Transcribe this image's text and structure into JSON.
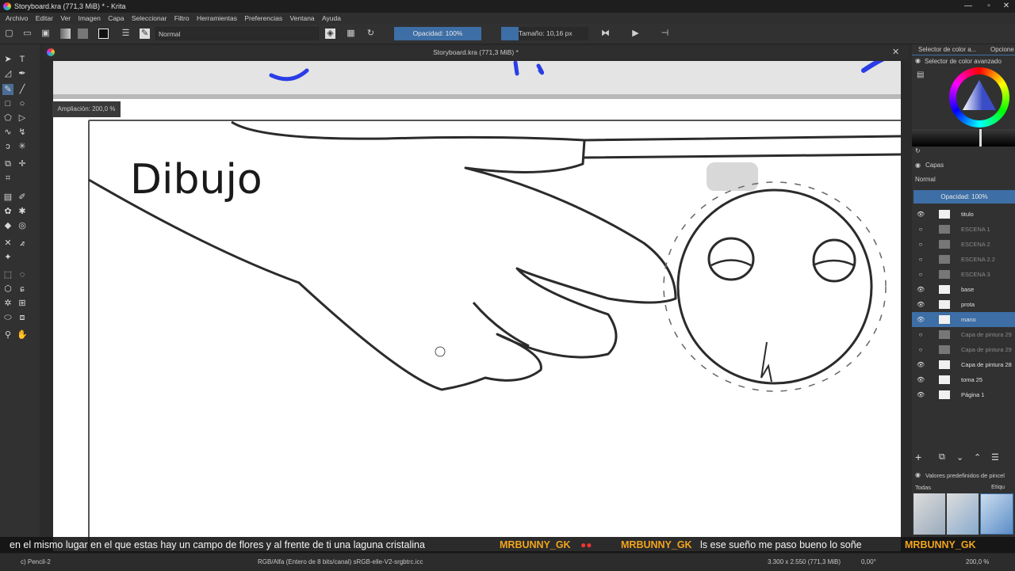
{
  "window": {
    "title": "Storyboard.kra (771,3 MiB) * - Krita"
  },
  "menu": [
    "Archivo",
    "Editar",
    "Ver",
    "Imagen",
    "Capa",
    "Seleccionar",
    "Filtro",
    "Herramientas",
    "Preferencias",
    "Ventana",
    "Ayuda"
  ],
  "toolbar": {
    "blend_mode": "Normal",
    "opacity": "Opacidad: 100%",
    "size": "Tamaño: 10,16 px"
  },
  "document": {
    "tab_title": "Storyboard.kra (771,3 MiB) *",
    "zoom_label": "Ampliación: 200,0 %",
    "canvas_text": "Dibujo"
  },
  "color_selector": {
    "tab1": "Selector de color a...",
    "tab2": "Opcione",
    "title": "Selector de color avanzado"
  },
  "layers": {
    "title": "Capas",
    "blend": "Normal",
    "opacity": "Opacidad:  100%",
    "items": [
      {
        "name": "titulo",
        "visible": true
      },
      {
        "name": "ESCENA 1",
        "visible": false
      },
      {
        "name": "ESCENA 2",
        "visible": false
      },
      {
        "name": "ESCENA 2.2",
        "visible": false
      },
      {
        "name": "ESCENA 3",
        "visible": false
      },
      {
        "name": "base",
        "visible": true
      },
      {
        "name": "prota",
        "visible": true
      },
      {
        "name": "mano",
        "visible": true,
        "selected": true
      },
      {
        "name": "Capa de pintura 29",
        "visible": false
      },
      {
        "name": "Capa de pintura 29",
        "visible": false
      },
      {
        "name": "Capa de pintura 28",
        "visible": true
      },
      {
        "name": "toma 25",
        "visible": true
      },
      {
        "name": "Página 1",
        "visible": true
      }
    ]
  },
  "brush_presets": {
    "title": "Valores predefinidos de pincel",
    "filter": "Todas",
    "tag": "Etiqu"
  },
  "chat": [
    {
      "type": "msg",
      "text": "en el mismo lugar en el que estas hay un campo de flores y al frente de ti una laguna cristalina"
    },
    {
      "type": "name",
      "text": "MRBUNNY_GK"
    },
    {
      "type": "name",
      "text": "MRBUNNY_GK"
    },
    {
      "type": "msg",
      "text": "ls ese sueño me paso bueno lo soñe"
    },
    {
      "type": "name",
      "text": "MRBUNNY_GK"
    }
  ],
  "status": {
    "tool": "c) Pencil-2",
    "color_space": "RGB/Alfa (Entero de 8 bits/canal)  sRGB-elle-V2-srgbtrc.icc",
    "dimensions": "3.300 x 2.550 (771,3 MiB)",
    "rotation": "0,00°",
    "zoom": "200,0 %"
  },
  "colors": {
    "accent": "#3d6ea5",
    "chat_name": "#f2a51c"
  }
}
